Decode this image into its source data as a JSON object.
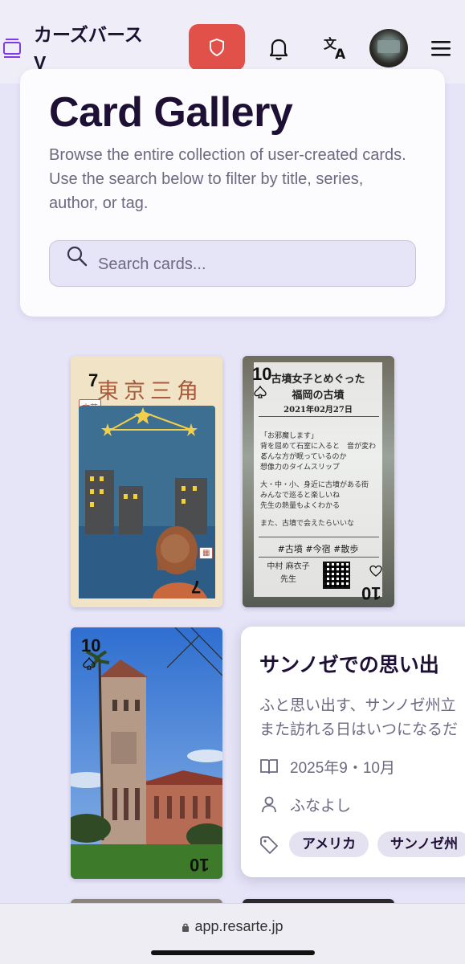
{
  "header": {
    "brand_title": "カーズバースV",
    "icons": [
      "layers-icon",
      "shield-icon",
      "bell-icon",
      "translate-icon",
      "avatar",
      "menu-icon"
    ],
    "shield_color": "#e2504a"
  },
  "intro": {
    "title": "Card Gallery",
    "description": "Browse the entire collection of user-created cards. Use the search below to filter by title, series, author, or tag.",
    "search_placeholder": "Search cards..."
  },
  "cards": [
    {
      "rank": "7",
      "title": "東京三角",
      "badge": "文芸"
    },
    {
      "rank": "10",
      "heading": "古墳女子とめぐった",
      "subheading": "福岡の古墳",
      "date": "2021年02月27日",
      "lines": [
        "「お邪魔します」",
        "背を屈めて石室に入ると　音が変わる",
        "どんな方が眠っているのか",
        "想像力のタイムスリップ",
        "大・中・小、身近に古墳がある街",
        "みんなで巡ると楽しいね",
        "先生の熱量もよくわかる",
        "また、古墳で会えたらいいな"
      ],
      "tags_line": "#古墳 #今宿 #散歩",
      "author": "中村 麻衣子",
      "author_suffix": "先生"
    },
    {
      "rank": "10"
    }
  ],
  "popover": {
    "title": "サンノゼでの思い出",
    "description_lines": [
      "ふと思い出す、サンノゼ州立",
      "また訪れる日はいつになるだ"
    ],
    "series": "2025年9・10月",
    "author": "ふなよし",
    "tags": [
      "アメリカ",
      "サンノゼ州"
    ]
  },
  "browser": {
    "url": "app.resarte.jp"
  }
}
